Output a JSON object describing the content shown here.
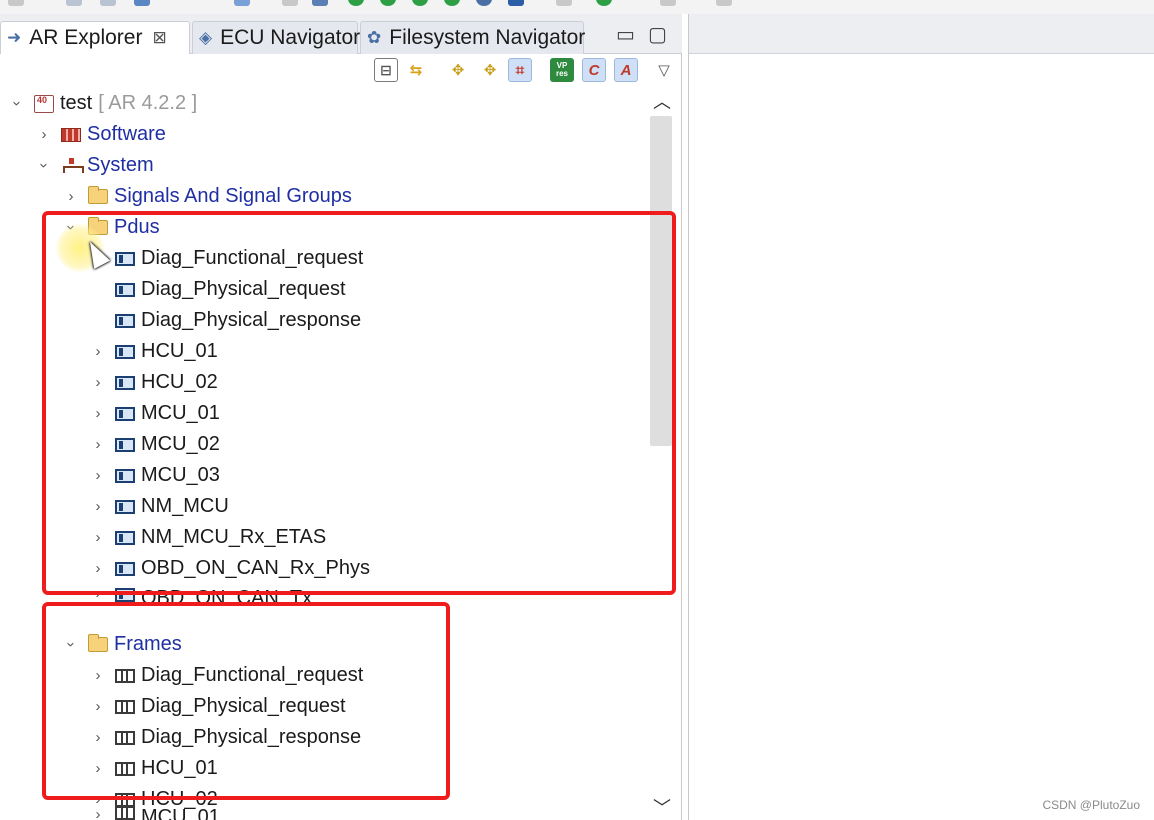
{
  "tabs": {
    "ar_explorer": "AR Explorer",
    "ecu_navigator": "ECU Navigator",
    "filesystem_navigator": "Filesystem Navigator",
    "close_glyph": "⊠"
  },
  "window_controls": {
    "minimize": "▭",
    "maximize": "▢"
  },
  "view_toolbar": {
    "vp_res": "VP res",
    "c_label": "C",
    "a_label": "A"
  },
  "tree": {
    "root": {
      "label": "test",
      "version": "[ AR 4.2.2 ]"
    },
    "software": "Software",
    "system": "System",
    "signals": "Signals And Signal Groups",
    "pdus": {
      "label": "Pdus",
      "items": [
        "Diag_Functional_request",
        "Diag_Physical_request",
        "Diag_Physical_response",
        "HCU_01",
        "HCU_02",
        "MCU_01",
        "MCU_02",
        "MCU_03",
        "NM_MCU",
        "NM_MCU_Rx_ETAS",
        "OBD_ON_CAN_Rx_Phys",
        "OBD_ON_CAN_Tx"
      ]
    },
    "frames": {
      "label": "Frames",
      "items": [
        "Diag_Functional_request",
        "Diag_Physical_request",
        "Diag_Physical_response",
        "HCU_01",
        "HCU_02",
        "MCU_01"
      ]
    }
  },
  "watermark": "CSDN @PlutoZuo",
  "colors": {
    "highlight": "#ee1c1c",
    "tree_link": "#1f2fa3"
  }
}
